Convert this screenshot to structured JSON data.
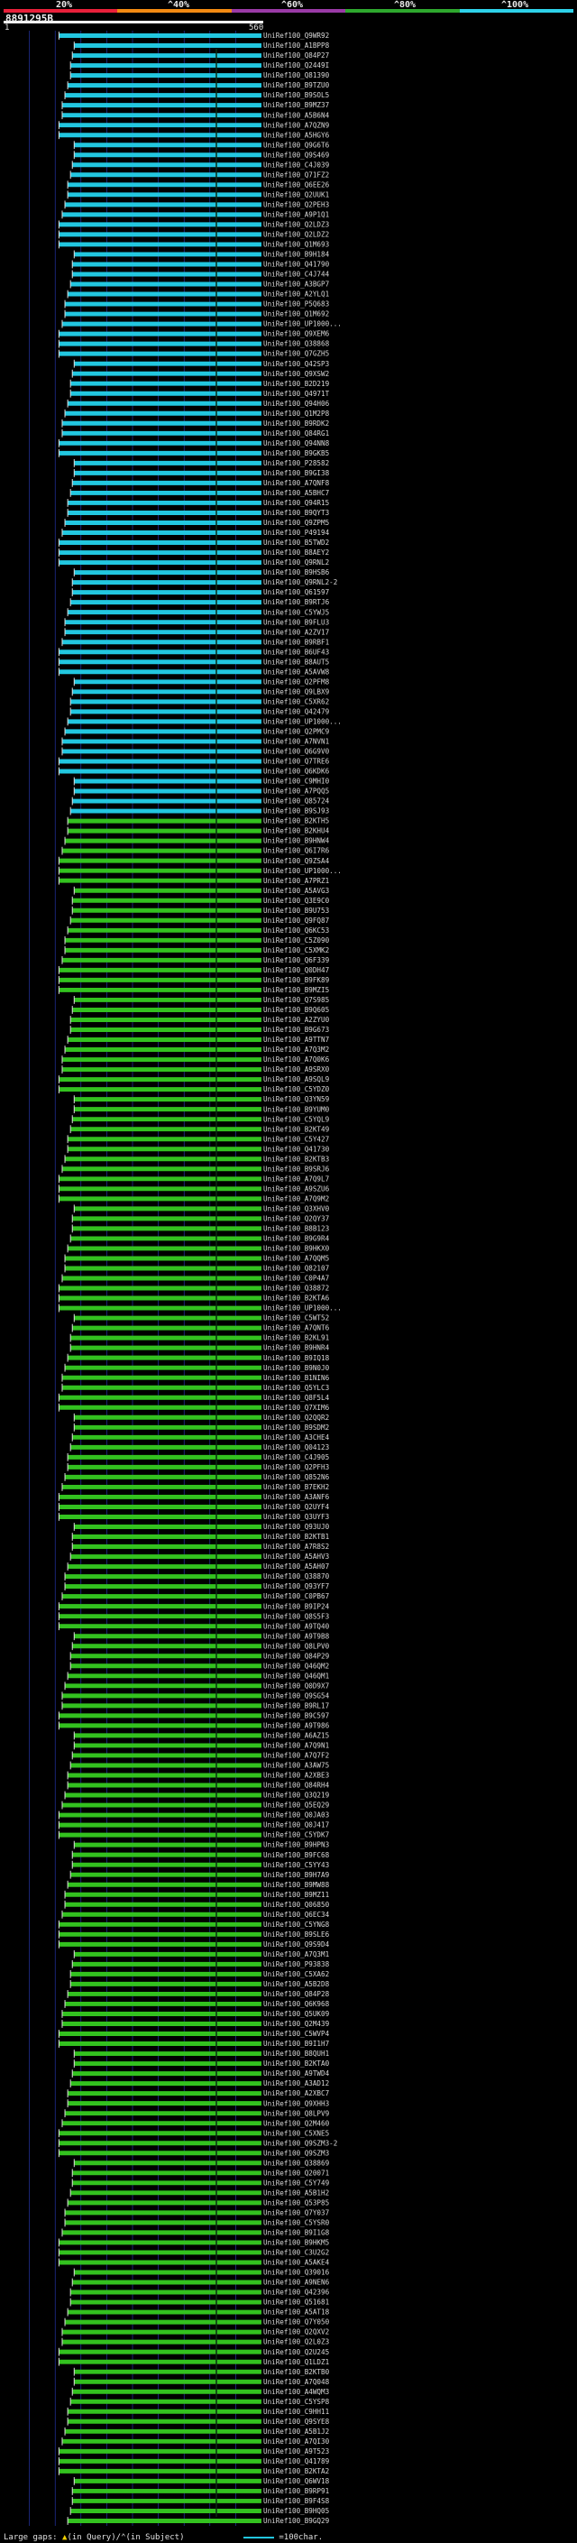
{
  "header": {
    "query_id": "8891295B",
    "scale_labels": [
      "20%",
      "^40%",
      "^60%",
      "^80%",
      "^100%"
    ],
    "ruler_start": "1",
    "ruler_end": "560"
  },
  "colors": {
    "background": "#000000",
    "cyan_hits": "#22c7e0",
    "green_hits": "#33c21f",
    "grid": "#2a3cbf",
    "scale": [
      "#e8203a",
      "#f28a12",
      "#9a3aa6",
      "#2ea82e",
      "#2ed2ea"
    ]
  },
  "footer": {
    "large_gaps": "Large gaps:",
    "in_query": "(in Query)/",
    "in_subject": "(in Subject)",
    "legend": "=100char."
  },
  "chart_data": {
    "type": "table",
    "x_range": [
      1,
      560
    ],
    "bands": [
      {
        "color": "cyan",
        "rows": 79
      },
      {
        "color": "green",
        "rows": 176
      }
    ],
    "hits": [
      "UniRef100_Q9WR92",
      "UniRef100_A1BPP8",
      "UniRef100_Q84P27",
      "UniRef100_Q2449I",
      "UniRef100_Q81390",
      "UniRef100_B9TZU0",
      "UniRef100_B9SOL5",
      "UniRef100_B9MZ37",
      "UniRef100_A5B6N4",
      "UniRef100_A7QZN9",
      "UniRef100_A5HGY6",
      "UniRef100_Q9G6T6",
      "UniRef100_Q9S469",
      "UniRef100_C4J039",
      "UniRef100_Q71FZ2",
      "UniRef100_Q6EE26",
      "UniRef100_Q2UUK1",
      "UniRef100_Q2PEH3",
      "UniRef100_A9P1Q1",
      "UniRef100_Q2LDZ3",
      "UniRef100_Q2LDZ2",
      "UniRef100_Q1M693",
      "UniRef100_B9H184",
      "UniRef100_Q41790",
      "UniRef100_C4J744",
      "UniRef100_A3BGP7",
      "UniRef100_A2YLQ1",
      "UniRef100_P5Q683",
      "UniRef100_Q1M692",
      "UniRef100_UP1000...",
      "UniRef100_Q9XEM6",
      "UniRef100_Q38868",
      "UniRef100_Q7GZH5",
      "UniRef100_Q42SP3",
      "UniRef100_Q9XSW2",
      "UniRef100_B2D219",
      "UniRef100_Q4971T",
      "UniRef100_Q94H06",
      "UniRef100_Q1M2P8",
      "UniRef100_B9RDK2",
      "UniRef100_Q84RG1",
      "UniRef100_Q94NN8",
      "UniRef100_B9GKB5",
      "UniRef100_P28582",
      "UniRef100_B9GI38",
      "UniRef100_A7QNF8",
      "UniRef100_A5BHC7",
      "UniRef100_Q94R15",
      "UniRef100_B9QYT3",
      "UniRef100_Q9ZPM5",
      "UniRef100_P49194",
      "UniRef100_B5TWD2",
      "UniRef100_B8AEY2",
      "UniRef100_Q9RNL2",
      "UniRef100_B9HSB6",
      "UniRef100_Q9RNL2-2",
      "UniRef100_Q61597",
      "UniRef100_B9RTJ6",
      "UniRef100_C5YWJ5",
      "UniRef100_B9FLU3",
      "UniRef100_A2ZV17",
      "UniRef100_B9RBF1",
      "UniRef100_B6UF43",
      "UniRef100_B8AUT5",
      "UniRef100_A5AVW8",
      "UniRef100_Q2PFM8",
      "UniRef100_Q9LBX9",
      "UniRef100_C5XR62",
      "UniRef100_Q42479",
      "UniRef100_UP1000...",
      "UniRef100_Q2PMC9",
      "UniRef100_A7NVN1",
      "UniRef100_Q6G9V0",
      "UniRef100_Q7TRE6",
      "UniRef100_Q6KDK6",
      "UniRef100_C9MHI0",
      "UniRef100_A7PQQ5",
      "UniRef100_Q85724",
      "UniRef100_B9SJ93",
      "UniRef100_B2KTH5",
      "UniRef100_B2KHU4",
      "UniRef100_B9HNW4",
      "UniRef100_Q6I7R6",
      "UniRef100_Q9ZSA4",
      "UniRef100_UP1000...",
      "UniRef100_A7PRZ1",
      "UniRef100_A5AVG3",
      "UniRef100_Q3E9C0",
      "UniRef100_B9U753",
      "UniRef100_Q9FQ87",
      "UniRef100_Q6KC53",
      "UniRef100_C5Z090",
      "UniRef100_C5XMK2",
      "UniRef100_Q6F339",
      "UniRef100_Q0DH47",
      "UniRef100_B9FK89",
      "UniRef100_B9MZI5",
      "UniRef100_Q7S985",
      "UniRef100_B9Q605",
      "UniRef100_A2ZYU0",
      "UniRef100_B9G673",
      "UniRef100_A9TTN7",
      "UniRef100_A7Q3M2",
      "UniRef100_A7Q0K6",
      "UniRef100_A9SRX0",
      "UniRef100_A9SQL9",
      "UniRef100_C5YDZ0",
      "UniRef100_Q3YN59",
      "UniRef100_B9YUM0",
      "UniRef100_C5YQL9",
      "UniRef100_B2KT49",
      "UniRef100_C5Y427",
      "UniRef100_Q41730",
      "UniRef100_B2KTB3",
      "UniRef100_B9SRJ6",
      "UniRef100_A7Q9L7",
      "UniRef100_A9SZU6",
      "UniRef100_A7Q9M2",
      "UniRef100_Q3XHV0",
      "UniRef100_Q2QY37",
      "UniRef100_B8B123",
      "UniRef100_B9G9R4",
      "UniRef100_B9HKX0",
      "UniRef100_A7QQM5",
      "UniRef100_Q82107",
      "UniRef100_C0P4A7",
      "UniRef100_Q38872",
      "UniRef100_B2KTA6",
      "UniRef100_UP1000...",
      "UniRef100_C5WT52",
      "UniRef100_A7QNT6",
      "UniRef100_B2KL91",
      "UniRef100_B9HNR4",
      "UniRef100_B9IQ18",
      "UniRef100_B9N0J0",
      "UniRef100_B1NIN6",
      "UniRef100_Q5YLC3",
      "UniRef100_Q8F5L4",
      "UniRef100_Q7XIM6",
      "UniRef100_Q2QQR2",
      "UniRef100_B9SDM2",
      "UniRef100_A3CHE4",
      "UniRef100_Q04123",
      "UniRef100_C4J905",
      "UniRef100_Q2PFH3",
      "UniRef100_Q852N6",
      "UniRef100_B7EKH2",
      "UniRef100_A3ANF6",
      "UniRef100_Q2UYF4",
      "UniRef100_Q3UYF3",
      "UniRef100_Q93UJ0",
      "UniRef100_B2KTB1",
      "UniRef100_A7R8S2",
      "UniRef100_A5AHV3",
      "UniRef100_A5AH07",
      "UniRef100_Q38870",
      "UniRef100_Q93YF7",
      "UniRef100_C0PB67",
      "UniRef100_B9IP24",
      "UniRef100_Q8S5F3",
      "UniRef100_A9TQ40",
      "UniRef100_A9T9B8",
      "UniRef100_Q8LPV0",
      "UniRef100_Q84P29",
      "UniRef100_Q46QM2",
      "UniRef100_Q46QM1",
      "UniRef100_Q0D9X7",
      "UniRef100_Q9SG54",
      "UniRef100_B9RL17",
      "UniRef100_B9C597",
      "UniRef100_A9T986",
      "UniRef100_A6AZ15",
      "UniRef100_A7Q9N1",
      "UniRef100_A7Q7F2",
      "UniRef100_A3AW75",
      "UniRef100_A2XBE3",
      "UniRef100_Q84RH4",
      "UniRef100_Q3Q219",
      "UniRef100_Q5EQ29",
      "UniRef100_Q0JA03",
      "UniRef100_Q0J417",
      "UniRef100_C5YDK7",
      "UniRef100_B9HPN3",
      "UniRef100_B9FC68",
      "UniRef100_C5YY43",
      "UniRef100_B9H7A9",
      "UniRef100_B9MW88",
      "UniRef100_B9MZ11",
      "UniRef100_Q06850",
      "UniRef100_Q6EC34",
      "UniRef100_C5YNG8",
      "UniRef100_B9SLE6",
      "UniRef100_Q9S9D4",
      "UniRef100_A7Q3M1",
      "UniRef100_P93838",
      "UniRef100_C5XA62",
      "UniRef100_A5B2D8",
      "UniRef100_Q84P28",
      "UniRef100_Q6K968",
      "UniRef100_Q5UK09",
      "UniRef100_Q2M439",
      "UniRef100_C5WVP4",
      "UniRef100_B9I1H7",
      "UniRef100_B8QUH1",
      "UniRef100_B2KTA0",
      "UniRef100_A9TWD4",
      "UniRef100_A3AD12",
      "UniRef100_A2XBC7",
      "UniRef100_Q9XHH3",
      "UniRef100_Q8LPV9",
      "UniRef100_Q2M460",
      "UniRef100_C5XNE5",
      "UniRef100_Q9SZM3-2",
      "UniRef100_Q9SZM3",
      "UniRef100_Q38869",
      "UniRef100_Q20071",
      "UniRef100_C5Y749",
      "UniRef100_A5B1H2",
      "UniRef100_Q53P85",
      "UniRef100_Q7Y037",
      "UniRef100_C5YSR0",
      "UniRef100_B9I1G8",
      "UniRef100_B9HKM5",
      "UniRef100_C3U2G2",
      "UniRef100_A5AKE4",
      "UniRef100_Q39016",
      "UniRef100_A9NEN6",
      "UniRef100_Q42396",
      "UniRef100_Q51681",
      "UniRef100_A5AT18",
      "UniRef100_Q7Y050",
      "UniRef100_Q2QXV2",
      "UniRef100_Q2L0Z3",
      "UniRef100_Q2U245",
      "UniRef100_Q1LDZ1",
      "UniRef100_B2KTB0",
      "UniRef100_A7Q048",
      "UniRef100_A4WQM3",
      "UniRef100_C5YSP8",
      "UniRef100_C9HH11",
      "UniRef100_Q9SYE8",
      "UniRef100_A5B1J2",
      "UniRef100_A7QI30",
      "UniRef100_A9T523",
      "UniRef100_Q41789",
      "UniRef100_B2KTA2",
      "UniRef100_Q6WV18",
      "UniRef100_B9RP91",
      "UniRef100_B9F4S8",
      "UniRef100_B9HQ05",
      "UniRef100_B9GQ29"
    ]
  }
}
